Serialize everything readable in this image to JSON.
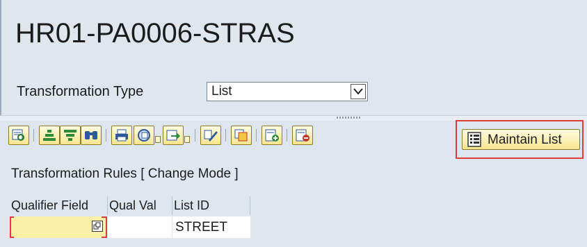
{
  "header": {
    "title": "HR01-PA0006-STRAS"
  },
  "transformation_type": {
    "label": "Transformation Type",
    "value": "List"
  },
  "toolbar": {
    "icons": [
      "details-icon",
      "sort-ascending-icon",
      "filter-icon",
      "find-icon",
      "print-icon",
      "layout-icon",
      "export-icon",
      "edit-icon",
      "copy-icon",
      "insert-row-icon",
      "delete-row-icon"
    ],
    "maintain_list_label": "Maintain List"
  },
  "section": {
    "title": "Transformation Rules [ Change Mode ]"
  },
  "table": {
    "columns": [
      "Qualifier Field",
      "Qual Val",
      "List ID"
    ],
    "rows": [
      {
        "qualifier_field": "",
        "qual_val": "",
        "list_id": "STREET"
      }
    ]
  },
  "colors": {
    "toolbar_button": "#f6e58f",
    "highlight": "#e03c3c",
    "required_cell": "#fcefa8"
  }
}
